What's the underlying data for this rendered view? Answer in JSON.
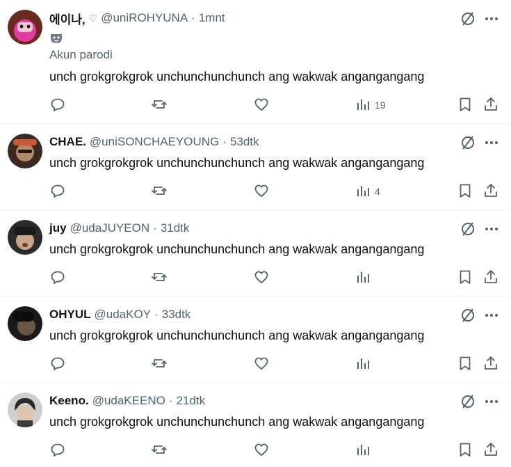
{
  "tweets": [
    {
      "name": "에이나,",
      "name_heart": "♡",
      "handle": "@uniROHYUNA",
      "separator": "·",
      "time": "1mnt",
      "badge_label": "Akun parodi",
      "text": "unch grokgrokgrok unchunchunchunch ang wakwak angangangang",
      "views": "19",
      "avatar_colors": [
        "#6b2a1f",
        "#e13ca0"
      ]
    },
    {
      "name": "CHAE.",
      "handle": "@uniSONCHAEYOUNG",
      "separator": "·",
      "time": "53dtk",
      "text": "unch grokgrokgrok unchunchunchunch ang wakwak angangangang",
      "views": "4",
      "avatar_colors": [
        "#3a2a22",
        "#b08a6a"
      ]
    },
    {
      "name": "juy",
      "handle": "@udaJUYEON",
      "separator": "·",
      "time": "31dtk",
      "text": "unch grokgrokgrok unchunchunchunch ang wakwak angangangang",
      "views": "",
      "avatar_colors": [
        "#2b2b2b",
        "#c9a58a"
      ]
    },
    {
      "name": "OHYUL",
      "handle": "@udaKOY",
      "separator": "·",
      "time": "33dtk",
      "text": "unch grokgrokgrok unchunchunchunch ang wakwak angangangang",
      "views": "",
      "avatar_colors": [
        "#1a1a1a",
        "#6b5448"
      ]
    },
    {
      "name": "Keeno.",
      "handle": "@udaKEENO",
      "separator": "·",
      "time": "21dtk",
      "text": "unch grokgrokgrok unchunchunchunch ang wakwak angangangang",
      "views": "",
      "avatar_colors": [
        "#cfcfcf",
        "#2a2a2a"
      ]
    }
  ],
  "colors": {
    "icon": "#536471",
    "text": "#0f1419",
    "divider": "#eff3f4"
  }
}
